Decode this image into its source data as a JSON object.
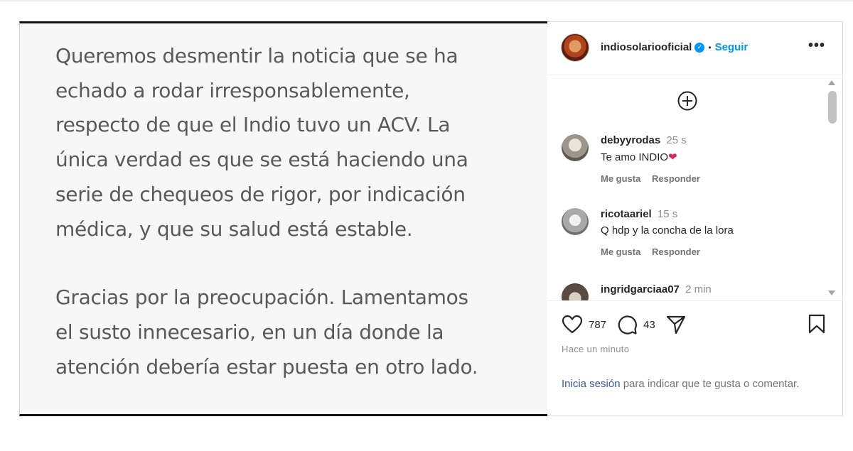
{
  "post": {
    "paragraph1": "Queremos desmentir la noticia que se ha\nechado a rodar irresponsablemente,\nrespecto de que el Indio tuvo un ACV. La\núnica verdad es que se está haciendo una\nserie de chequeos de rigor, por indicación\nmédica, y que su salud está estable.",
    "paragraph2": "Gracias por la preocupación. Lamentamos\nel susto innecesario, en un día donde la\natención debería estar puesta en otro lado."
  },
  "header": {
    "username": "indiosolariooficial",
    "verified_mark": "✓",
    "separator": "•",
    "follow_label": "Seguir",
    "more_icon": "•••"
  },
  "comments": [
    {
      "user": "debyyrodas",
      "time": "25 s",
      "text": "Te amo INDIO",
      "emoji": "❤",
      "like_label": "Me gusta",
      "reply_label": "Responder",
      "avatar_color": "#c9c4b8"
    },
    {
      "user": "ricotaariel",
      "time": "15 s",
      "text": "Q hdp y la concha de la lora",
      "like_label": "Me gusta",
      "reply_label": "Responder",
      "avatar_color": "#bdbdbd"
    },
    {
      "user": "ingridgarciaa07",
      "time": "2 min",
      "avatar_color": "#7a6a5e"
    }
  ],
  "actions": {
    "likes": "787",
    "comments": "43",
    "time_ago": "Hace un minuto",
    "login_link": "Inicia sesión",
    "login_rest": " para indicar que te gusta o comentar."
  },
  "colors": {
    "accent": "#0095f6",
    "text": "#262626",
    "muted": "#8e8e8e"
  }
}
